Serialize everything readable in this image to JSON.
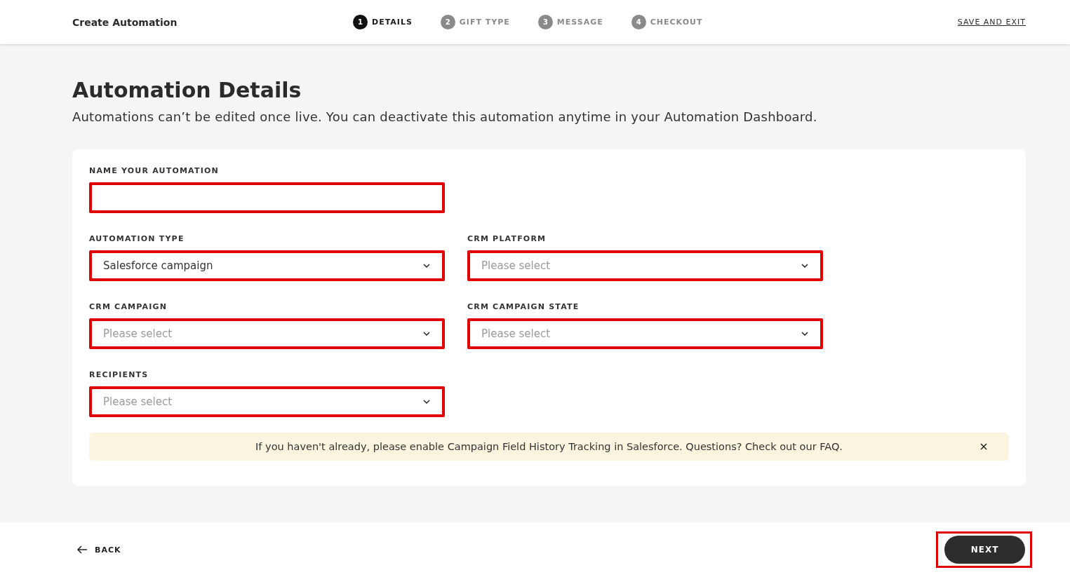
{
  "header": {
    "title": "Create Automation",
    "steps": [
      {
        "number": "1",
        "label": "DETAILS",
        "selected": true
      },
      {
        "number": "2",
        "label": "GIFT TYPE",
        "selected": false
      },
      {
        "number": "3",
        "label": "MESSAGE",
        "selected": false
      },
      {
        "number": "4",
        "label": "CHECKOUT",
        "selected": false
      }
    ],
    "save_link": "SAVE AND EXIT"
  },
  "page": {
    "title": "Automation Details",
    "subtitle": "Automations can’t be edited once live. You can deactivate this automation anytime in your Automation Dashboard."
  },
  "form": {
    "fields": [
      {
        "kind": "text",
        "label": "NAME YOUR AUTOMATION",
        "highlighted": true
      },
      {
        "kind": "spacer"
      },
      {
        "kind": "select",
        "label": "AUTOMATION TYPE",
        "value": "Salesforce campaign",
        "highlighted": true
      },
      {
        "kind": "select",
        "label": "CRM PLATFORM",
        "placeholder": "Please select",
        "highlighted": true
      },
      {
        "kind": "select",
        "label": "CRM CAMPAIGN",
        "placeholder": "Please select",
        "highlighted": true
      },
      {
        "kind": "select",
        "label": "CRM CAMPAIGN STATE",
        "placeholder": "Please select",
        "highlighted": true
      },
      {
        "kind": "select",
        "label": "RECIPIENTS",
        "placeholder": "Please select",
        "highlighted": true
      }
    ],
    "notice": {
      "text": "If you haven't already, please enable Campaign Field History Tracking in Salesforce. Questions? Check out our",
      "link": "FAQ",
      "end": "."
    }
  },
  "footer": {
    "back": "BACK",
    "next": {
      "label": "NEXT",
      "highlighted": true
    }
  }
}
